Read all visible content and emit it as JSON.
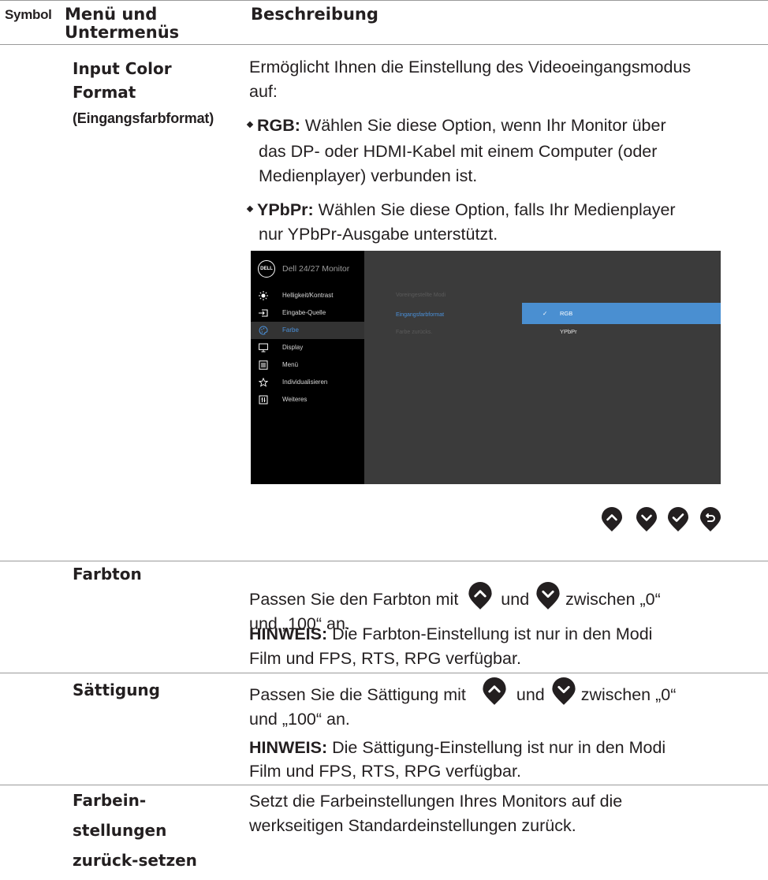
{
  "header": {
    "symbol": "Symbol",
    "menu_line1": "Menü und",
    "menu_line2": "Untermenüs",
    "description": "Beschreibung"
  },
  "input_color": {
    "title_line1": "Input Color",
    "title_line2": "Format",
    "subtitle": "(Eingangsfarbformat)",
    "intro_line1": "Ermöglicht Ihnen die Einstellung des Videoeingangsmodus",
    "intro_line2": "auf:",
    "rgb_term": "RGB:",
    "rgb_line1": " Wählen Sie diese Option, wenn Ihr Monitor über",
    "rgb_line2": "das DP- oder HDMI-Kabel mit einem Computer (oder",
    "rgb_line3": "Medienplayer) verbunden ist.",
    "ypbpr_term": "YPbPr:",
    "ypbpr_line1": " Wählen Sie diese Option, falls Ihr Medienplayer",
    "ypbpr_line2": "nur YPbPr-Ausgabe unterstützt."
  },
  "osd": {
    "logo": "DELL",
    "model": "Dell 24/27 Monitor",
    "menu_items": [
      {
        "label": "Helligkeit/Kontrast",
        "icon": "brightness-icon"
      },
      {
        "label": "Eingabe-Quelle",
        "icon": "input-source-icon"
      },
      {
        "label": "Farbe",
        "icon": "color-icon"
      },
      {
        "label": "Display",
        "icon": "display-icon"
      },
      {
        "label": "Menü",
        "icon": "menu-icon"
      },
      {
        "label": "Individualisieren",
        "icon": "star-icon"
      },
      {
        "label": "Weiteres",
        "icon": "others-icon"
      }
    ],
    "active_item": "Farbe",
    "sub_items": [
      "Voreingestellte Modi",
      "Eingangsfarbformat",
      "Farbe zurücks."
    ],
    "options": [
      "RGB",
      "YPbPr"
    ],
    "selected_option": "RGB",
    "accent_color": "#4a8fd1"
  },
  "nav_buttons": [
    "up-button-icon",
    "down-button-icon",
    "check-button-icon",
    "back-button-icon"
  ],
  "hue": {
    "title": "Farbton",
    "text_part1": "Passen Sie den Farbton mit",
    "text_part2": "und",
    "text_part3": "zwischen „0“",
    "text_line2": "und „100“ an.",
    "note_term": "HINWEIS:",
    "note_line1": " Die Farbton-Einstellung ist nur in den Modi",
    "note_line2": "Film und FPS, RTS, RPG verfügbar."
  },
  "saturation": {
    "title": "Sättigung",
    "text_part1": "Passen Sie die Sättigung mit",
    "text_part2": "und",
    "text_part3": "zwischen „0“",
    "text_line2": "und „100“ an.",
    "note_term": "HINWEIS:",
    "note_line1": " Die Sättigung-Einstellung ist nur in den Modi",
    "note_line2": "Film und FPS, RTS, RPG verfügbar."
  },
  "reset": {
    "title_line1": "Farbein-",
    "title_line2": "stellungen",
    "title_line3": "zurück-setzen",
    "desc_line1": "Setzt die Farbeinstellungen Ihres Monitors auf die",
    "desc_line2": "werkseitigen Standardeinstellungen zurück."
  }
}
